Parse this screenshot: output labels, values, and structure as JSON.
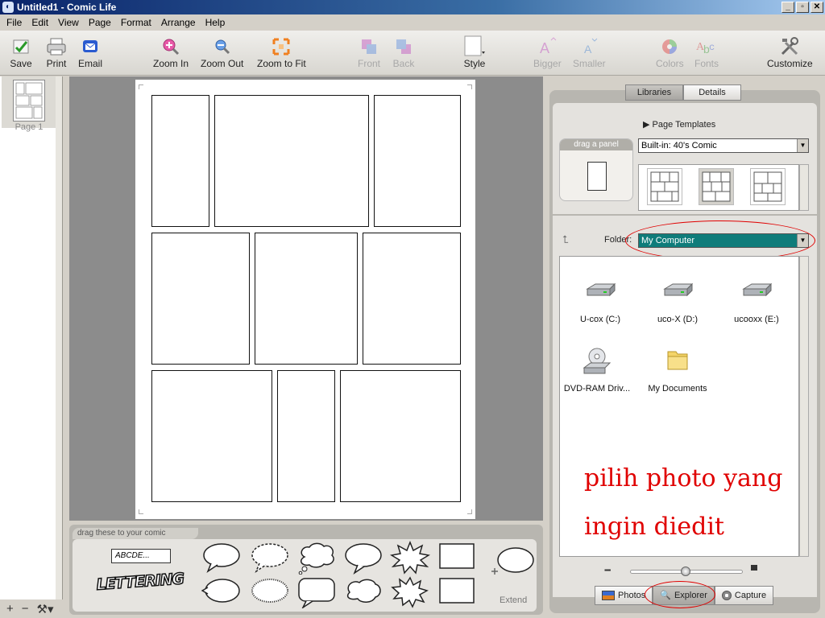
{
  "window": {
    "title": "Untitled1 - Comic Life"
  },
  "menu": [
    "File",
    "Edit",
    "View",
    "Page",
    "Format",
    "Arrange",
    "Help"
  ],
  "toolbar": {
    "save": "Save",
    "print": "Print",
    "email": "Email",
    "zoom_in": "Zoom In",
    "zoom_out": "Zoom Out",
    "zoom_fit": "Zoom to Fit",
    "front": "Front",
    "back": "Back",
    "style": "Style",
    "bigger": "Bigger",
    "smaller": "Smaller",
    "colors": "Colors",
    "fonts": "Fonts",
    "customize": "Customize"
  },
  "pages": {
    "label": "Page 1"
  },
  "tray": {
    "label": "drag these to your comic",
    "lettering_sample": "ABCDE...",
    "lettering_art": "LETTERING",
    "extend": "Extend"
  },
  "library": {
    "tabs": [
      "Libraries",
      "Details"
    ],
    "page_templates": "Page Templates",
    "drag_panel": "drag a panel",
    "template_select": "Built-in: 40's Comic",
    "folder_label": "Folder:",
    "folder_value": "My Computer",
    "files": [
      {
        "name": "U-cox (C:)",
        "icon": "drive-icon"
      },
      {
        "name": "uco-X (D:)",
        "icon": "drive-icon"
      },
      {
        "name": "ucooxx (E:)",
        "icon": "drive-icon"
      },
      {
        "name": "DVD-RAM Driv...",
        "icon": "dvd-drive-icon"
      },
      {
        "name": "My Documents",
        "icon": "folder-icon"
      }
    ],
    "annotation_line1": "pilih photo yang",
    "annotation_line2": "ingin diedit",
    "bottom_tabs": [
      "Photos",
      "Explorer",
      "Capture"
    ]
  },
  "colors": {
    "annotation": "#e00000",
    "folder_highlight": "#0f7c7a"
  }
}
